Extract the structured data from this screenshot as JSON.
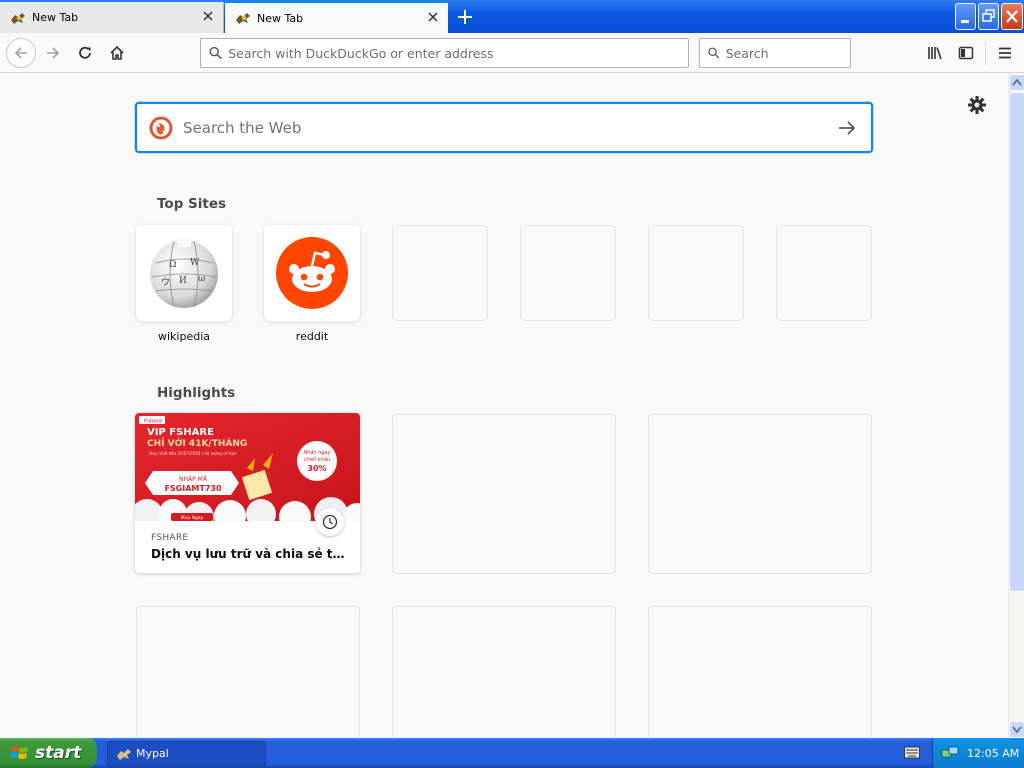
{
  "tabs": [
    {
      "label": "New Tab",
      "active": false
    },
    {
      "label": "New Tab",
      "active": true
    }
  ],
  "navbar": {
    "url_placeholder": "Search with DuckDuckGo or enter address",
    "search_placeholder": "Search"
  },
  "newtab": {
    "web_search_placeholder": "Search the Web",
    "top_sites_title": "Top Sites",
    "top_sites": [
      {
        "label": "wikipedia",
        "icon": "wikipedia-globe-icon"
      },
      {
        "label": "reddit",
        "icon": "reddit-alien-icon"
      }
    ],
    "highlights_title": "Highlights",
    "highlight": {
      "source": "FSHARE",
      "title": "Dịch vụ lưu trữ và chia sẻ trực t...",
      "banner": {
        "brand": "Fshare",
        "headline1": "VIP FSHARE",
        "headline2": "CHỈ VỚI 41K/THÁNG",
        "fineprint": "Duy nhất đến 31/07/2020 | Số lượng có hạn",
        "badge_line1": "Nhận ngay",
        "badge_line2": "chiết khấu",
        "badge_pct": "30%",
        "code_label": "NHẬP MÃ",
        "code": "FSGIAMT730",
        "cta": "Mua Ngay"
      }
    }
  },
  "taskbar": {
    "start_label": "start",
    "task_label": "Mypal",
    "clock": "12:05 AM"
  },
  "colors": {
    "accent": "#0a84ff",
    "reddit": "#ff4500",
    "xp_blue": "#245edb",
    "xp_green": "#3c9a3c"
  }
}
